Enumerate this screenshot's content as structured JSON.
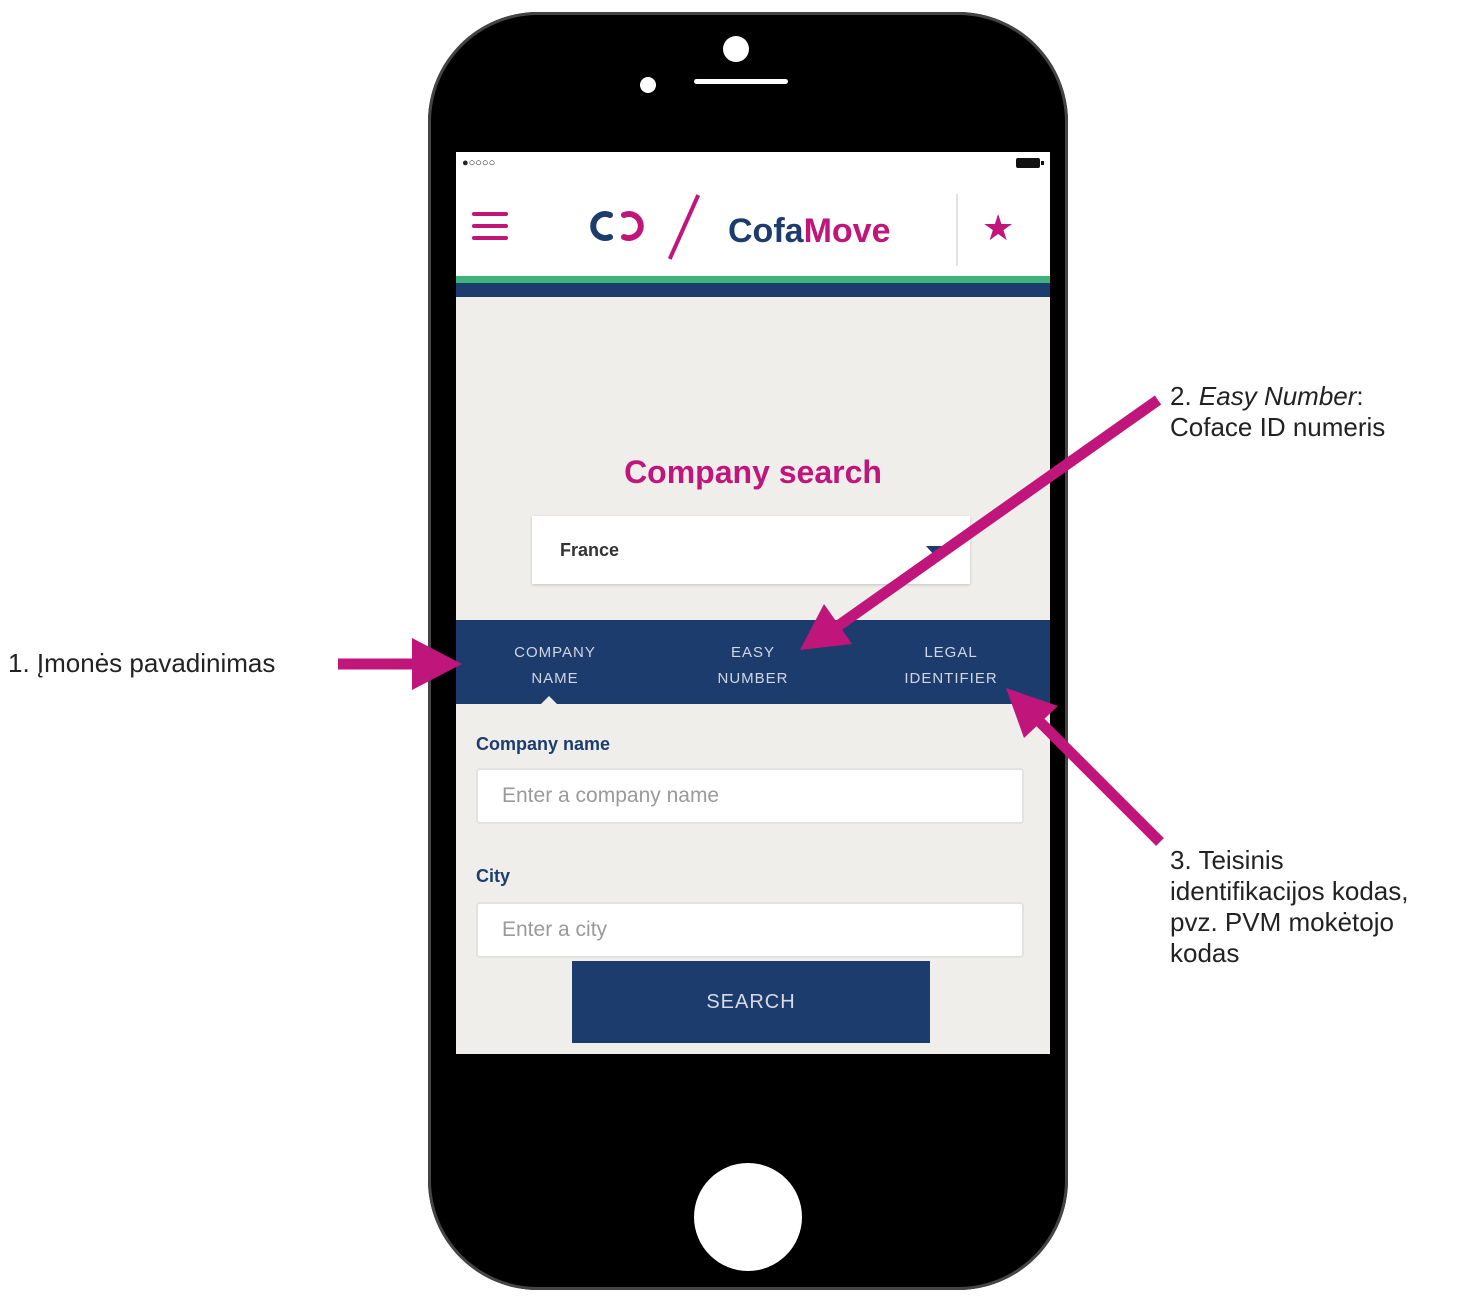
{
  "device": {
    "status_bar": {
      "signal": "●○○○○"
    }
  },
  "app": {
    "brand_prefix": "Cofa",
    "brand_suffix": "Move",
    "star_icon": "★",
    "search_title": "Company search",
    "country_select": {
      "value": "France"
    },
    "tabs": [
      {
        "label": "COMPANY\nNAME",
        "active": true
      },
      {
        "label": "EASY\nNUMBER",
        "active": false
      },
      {
        "label": "LEGAL\nIDENTIFIER",
        "active": false
      }
    ],
    "form": {
      "company_label": "Company name",
      "company_placeholder": "Enter a company name",
      "city_label": "City",
      "city_placeholder": "Enter a city",
      "search_label": "SEARCH"
    },
    "colors": {
      "accent": "#c0157a",
      "navy": "#1d3c6e",
      "green": "#3fb47a"
    }
  },
  "annotations": {
    "item1": "1. Įmonės pavadinimas",
    "item2_prefix": "2. ",
    "item2_term": "Easy Number",
    "item2_suffix": ":",
    "item2_line2": "Coface ID numeris",
    "item3_line1": "3. Teisinis",
    "item3_line2": "identifikacijos kodas,",
    "item3_line3": "pvz. PVM mokėtojo",
    "item3_line4": "kodas",
    "arrow_color": "#c0157a"
  }
}
